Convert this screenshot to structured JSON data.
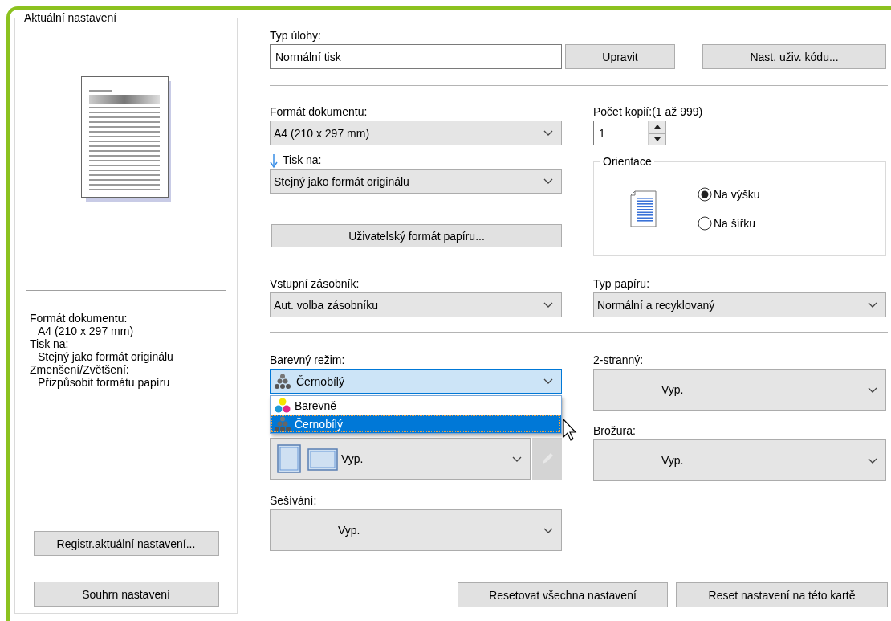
{
  "current_settings": {
    "title": "Aktuální nastavení",
    "summary": [
      {
        "label": "Formát dokumentu:",
        "value": "A4 (210 x 297 mm)"
      },
      {
        "label": "Tisk na:",
        "value": "Stejný jako formát originálu"
      },
      {
        "label": "Zmenšení/Zvětšení:",
        "value": "Přizpůsobit formátu papíru"
      }
    ],
    "buttons": [
      "Registr.aktuální nastavení...",
      "Souhrn nastavení"
    ]
  },
  "job_type": {
    "label": "Typ úlohy:",
    "value": "Normální tisk",
    "buttons": [
      "Upravit",
      "Nast. uživ. kódu..."
    ]
  },
  "document_format": {
    "label": "Formát dokumentu:",
    "value": "A4 (210 x 297 mm)"
  },
  "copies": {
    "label": "Počet kopií:(1 až 999)",
    "value": "1"
  },
  "print_on": {
    "label": "Tisk na:",
    "value": "Stejný jako formát originálu"
  },
  "custom_paper_button": "Uživatelský formát papíru...",
  "orientation": {
    "title": "Orientace",
    "options": [
      {
        "label": "Na výšku",
        "selected": true
      },
      {
        "label": "Na šířku",
        "selected": false
      }
    ]
  },
  "input_tray": {
    "label": "Vstupní zásobník:",
    "value": "Aut. volba zásobníku"
  },
  "paper_type": {
    "label": "Typ papíru:",
    "value": "Normální a recyklovaný"
  },
  "color_mode": {
    "label": "Barevný režim:",
    "value": "Černobílý",
    "expanded": true,
    "options": [
      {
        "label": "Barevně",
        "kind": "color",
        "selected": false
      },
      {
        "label": "Černobílý",
        "kind": "mono",
        "selected": true
      }
    ]
  },
  "duplex": {
    "label": "2-stranný:",
    "value": "Vyp."
  },
  "layout_combo": {
    "value": "Vyp."
  },
  "booklet": {
    "label": "Brožura:",
    "value": "Vyp."
  },
  "stapling": {
    "label": "Sešívání:",
    "value": "Vyp."
  },
  "footer_buttons": [
    "Resetovat všechna nastavení",
    "Reset nastavení na této kartě"
  ]
}
